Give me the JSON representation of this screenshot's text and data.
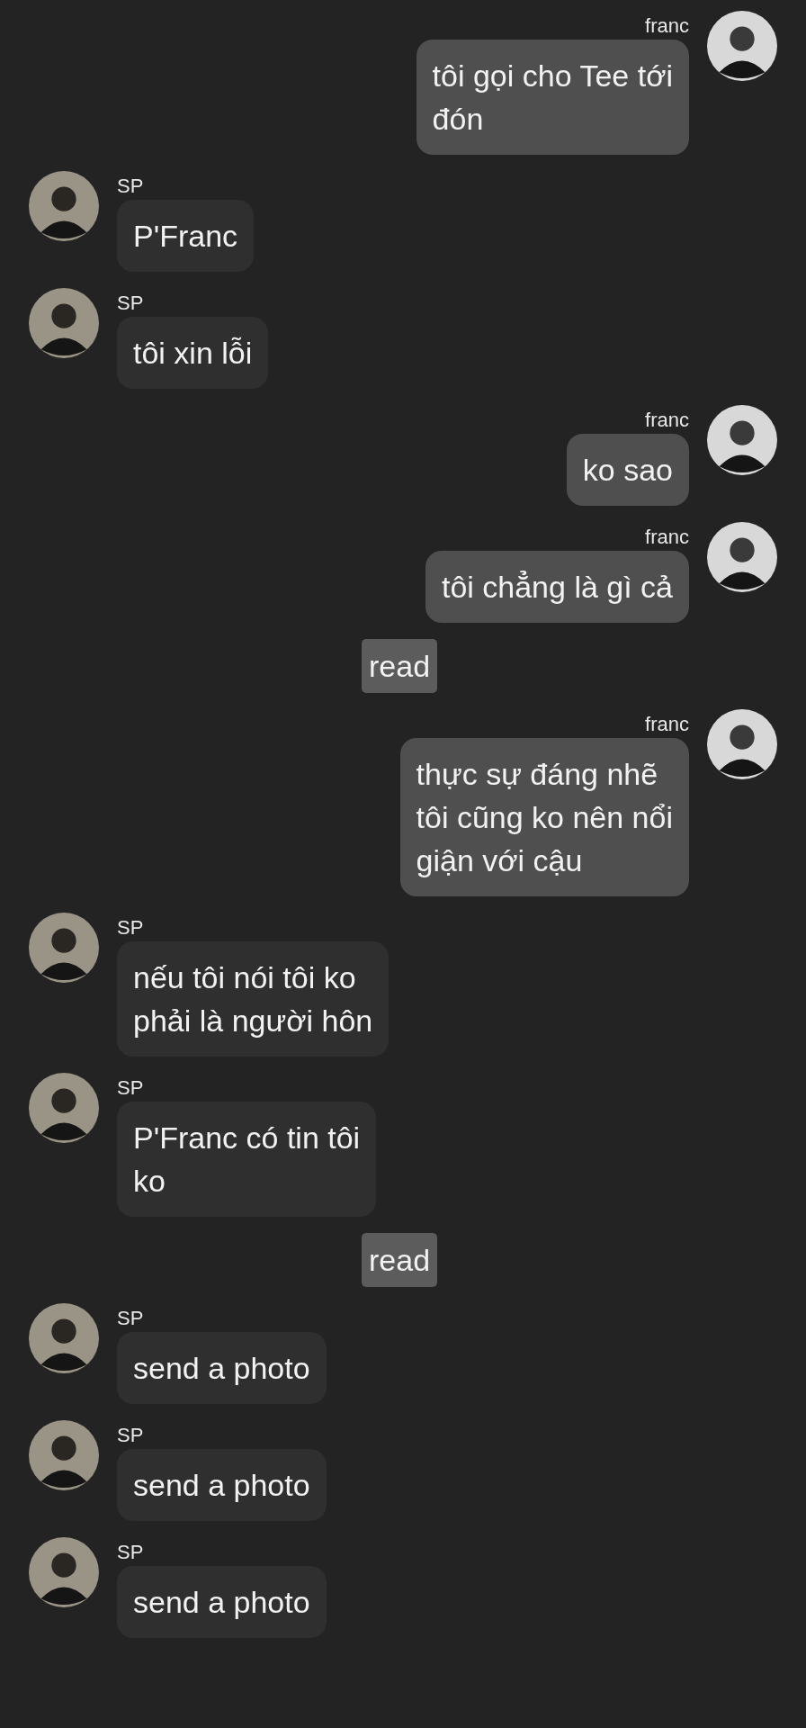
{
  "messages": [
    {
      "kind": "message",
      "outgoing": true,
      "name": "franc",
      "lines": [
        "tôi gọi cho Tee tới",
        "đón"
      ]
    },
    {
      "kind": "message",
      "outgoing": false,
      "name": "SP",
      "lines": [
        "P'Franc"
      ]
    },
    {
      "kind": "message",
      "outgoing": false,
      "name": "SP",
      "lines": [
        "tôi xin lỗi"
      ]
    },
    {
      "kind": "message",
      "outgoing": true,
      "name": "franc",
      "lines": [
        "ko sao"
      ]
    },
    {
      "kind": "message",
      "outgoing": true,
      "name": "franc",
      "lines": [
        "tôi chẳng là gì cả"
      ]
    },
    {
      "kind": "status",
      "text": "read"
    },
    {
      "kind": "message",
      "outgoing": true,
      "name": "franc",
      "lines": [
        "thực sự đáng nhẽ",
        "tôi cũng ko nên nổi",
        "giận với cậu"
      ]
    },
    {
      "kind": "message",
      "outgoing": false,
      "name": "SP",
      "lines": [
        "nếu tôi nói tôi ko",
        "phải là người hôn"
      ]
    },
    {
      "kind": "message",
      "outgoing": false,
      "name": "SP",
      "lines": [
        "P'Franc có tin tôi",
        "ko"
      ]
    },
    {
      "kind": "status",
      "text": "read"
    },
    {
      "kind": "message",
      "outgoing": false,
      "name": "SP",
      "lines": [
        "send a photo"
      ]
    },
    {
      "kind": "message",
      "outgoing": false,
      "name": "SP",
      "lines": [
        "send a photo"
      ]
    },
    {
      "kind": "message",
      "outgoing": false,
      "name": "SP",
      "lines": [
        "send a photo"
      ]
    }
  ]
}
